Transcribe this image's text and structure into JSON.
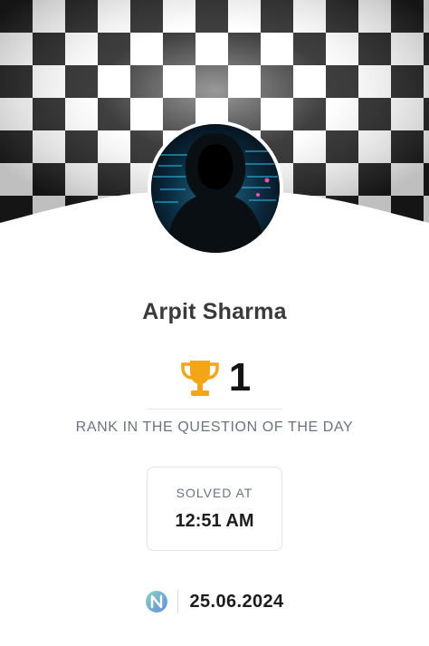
{
  "profile": {
    "name": "Arpit Sharma",
    "avatar_icon": "hooded-hacker-avatar"
  },
  "rank": {
    "value": "1",
    "icon": "trophy-icon",
    "label": "RANK IN THE QUESTION OF THE DAY"
  },
  "solved": {
    "label": "SOLVED AT",
    "time": "12:51 AM"
  },
  "footer": {
    "logo_icon": "n-logo-icon",
    "date": "25.06.2024"
  },
  "colors": {
    "trophy": "#f2a516",
    "text_dark": "#1c1c1c",
    "text_muted": "#6c7380",
    "checker_dark": "#1a1a1a",
    "checker_light": "#ffffff"
  }
}
